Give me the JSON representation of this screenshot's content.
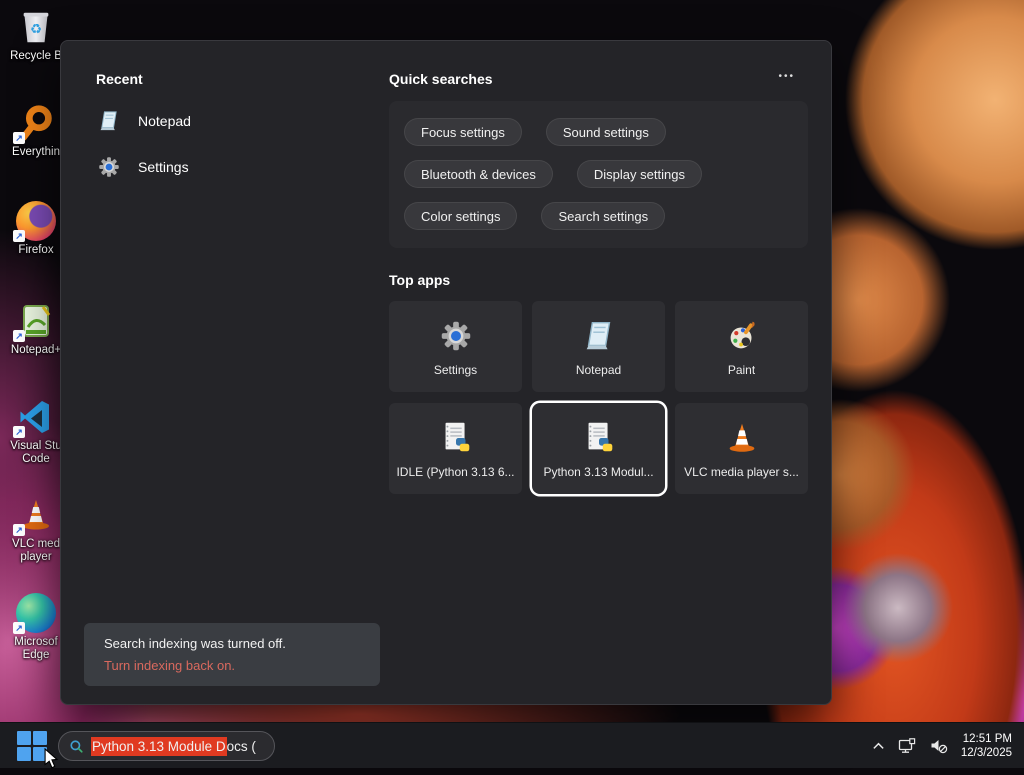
{
  "desktop": {
    "icons": [
      {
        "label": "Recycle B"
      },
      {
        "label": "Everythin"
      },
      {
        "label": "Firefox"
      },
      {
        "label": "Notepad+"
      },
      {
        "label": "Visual Stu Code"
      },
      {
        "label": "VLC med player"
      },
      {
        "label": "Microsof Edge"
      }
    ]
  },
  "panel": {
    "recent": {
      "title": "Recent",
      "items": [
        {
          "label": "Notepad"
        },
        {
          "label": "Settings"
        }
      ]
    },
    "quick_searches": {
      "title": "Quick searches",
      "more_label": "•••",
      "pills": [
        "Focus settings",
        "Sound settings",
        "Bluetooth & devices",
        "Display settings",
        "Color settings",
        "Search settings"
      ]
    },
    "top_apps": {
      "title": "Top apps",
      "tiles": [
        {
          "label": "Settings"
        },
        {
          "label": "Notepad"
        },
        {
          "label": "Paint"
        },
        {
          "label": "IDLE (Python 3.13 6..."
        },
        {
          "label": "Python 3.13 Modul...",
          "selected": true
        },
        {
          "label": "VLC media player s..."
        }
      ]
    },
    "notice": {
      "message": "Search indexing was turned off.",
      "link": "Turn indexing back on."
    }
  },
  "taskbar": {
    "search": {
      "selected_text": "Python 3.13 Module D",
      "rest_text": "ocs ("
    },
    "clock": {
      "time": "12:51 PM",
      "date": "12/3/2025"
    }
  },
  "colors": {
    "selection_red": "#e03a21",
    "notice_link_red": "#d9695e",
    "accent_blue": "#4fa3ef",
    "panel_bg": "#242428",
    "taskbar_bg": "#1b1c20"
  }
}
